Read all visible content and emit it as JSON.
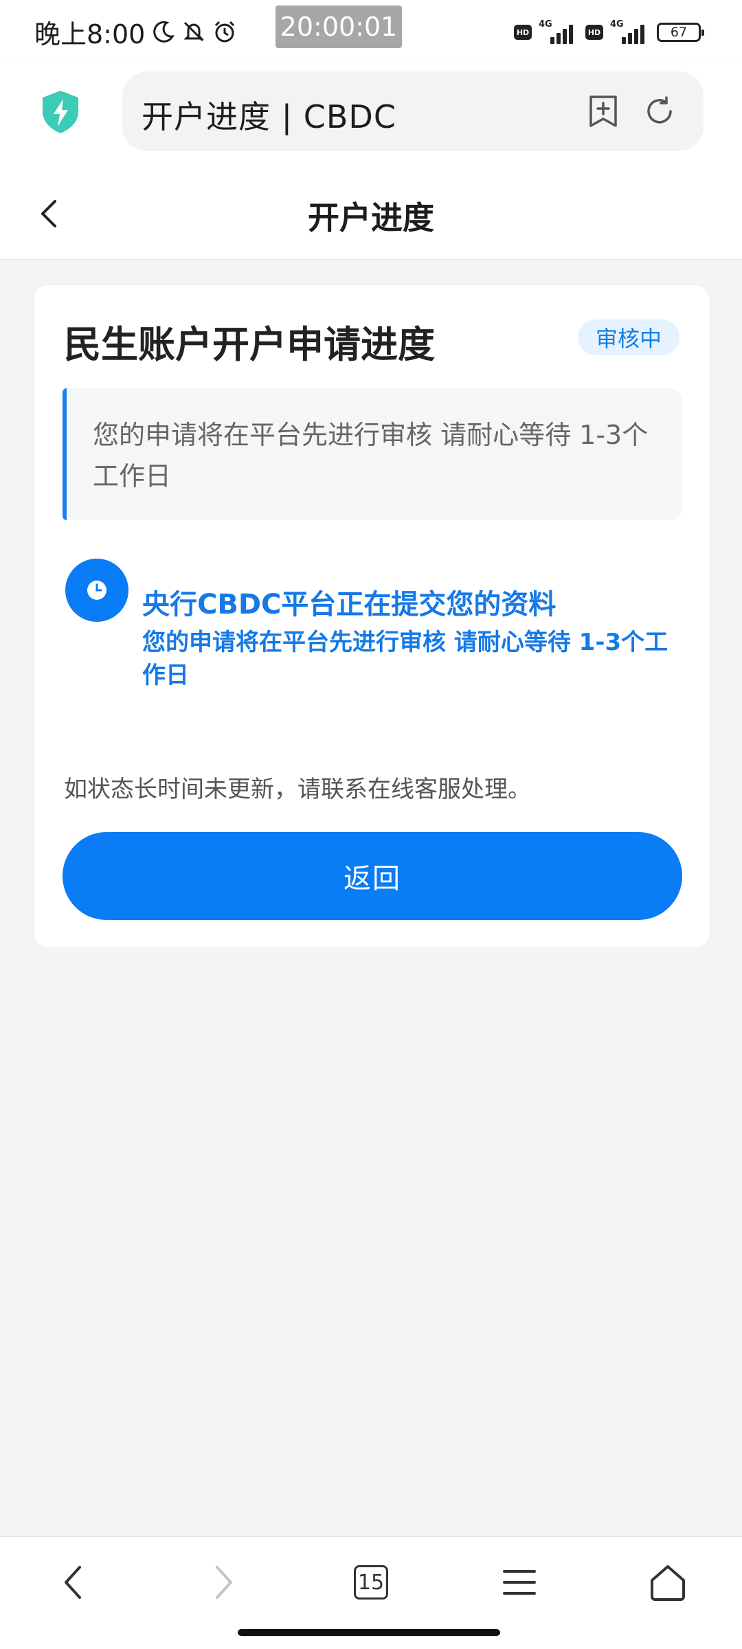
{
  "status_bar": {
    "time": "晚上8:00",
    "clock_overlay": "20:00:01",
    "network_label": "4G",
    "hd_label": "HD",
    "battery": "67"
  },
  "browser": {
    "url_title": "开户进度 | CBDC"
  },
  "header": {
    "title": "开户进度"
  },
  "card": {
    "title": "民生账户开户申请进度",
    "status_badge": "审核中",
    "notice": "您的申请将在平台先进行审核 请耐心等待 1-3个工作日",
    "step_title": "央行CBDC平台正在提交您的资料",
    "step_desc": "您的申请将在平台先进行审核 请耐心等待 1-3个工作日",
    "hint": "如状态长时间未更新，请联系在线客服处理。",
    "return_label": "返回"
  },
  "bottom_nav": {
    "tabs_count": "15"
  },
  "colors": {
    "accent": "#0a7cf5",
    "badge_bg": "#e6f2ff",
    "shield": "#3ccbb5"
  }
}
